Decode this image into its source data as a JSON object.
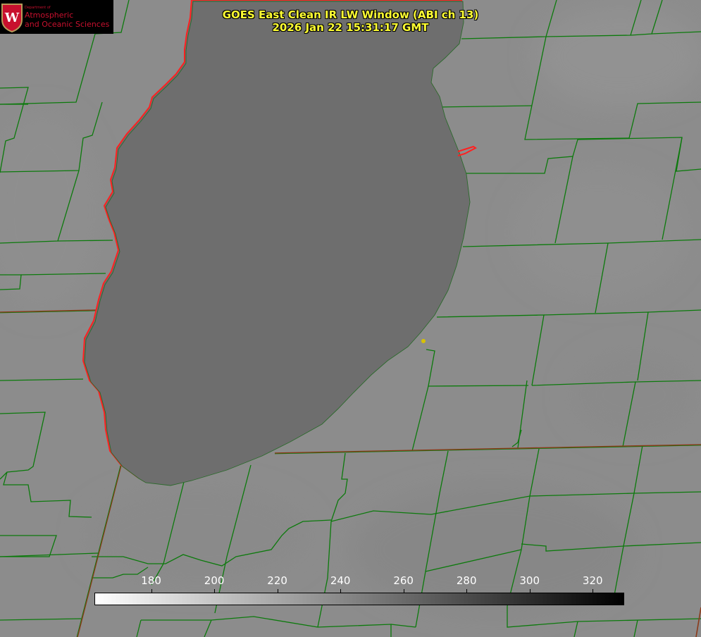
{
  "title": {
    "line1": "GOES East Clean IR LW Window (ABI ch 13)",
    "line2": "2026 Jan 22 15:31:17 GMT"
  },
  "logo": {
    "department": "Department of",
    "line1": "Atmospheric",
    "line2": "and Oceanic Sciences",
    "seal_letter": "W"
  },
  "colorbar": {
    "min": 162,
    "max": 330,
    "gradient": [
      "#ffffff",
      "#000000"
    ],
    "ticks": [
      "180",
      "200",
      "220",
      "240",
      "260",
      "280",
      "300",
      "320"
    ]
  },
  "colors": {
    "background": "#8a8a8a",
    "county_lines": "#0c7a0c",
    "state_lines": "#8b3a1a",
    "lake_outline": "#ff2020",
    "title_text": "#ffff33",
    "logo_text": "#c8102e",
    "marker": "#d8c200"
  }
}
